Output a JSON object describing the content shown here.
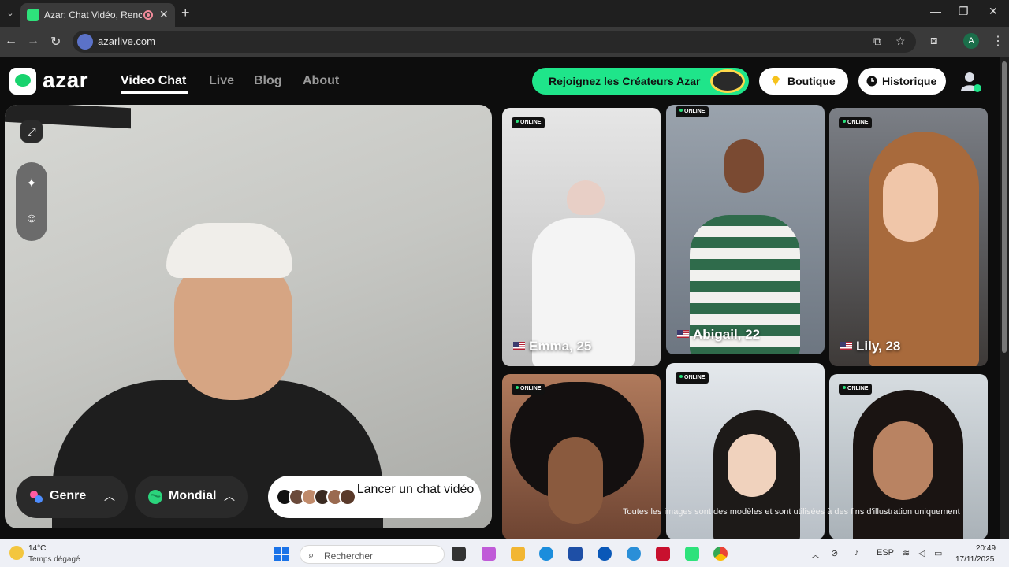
{
  "browser": {
    "tab_title": "Azar: Chat Vidéo, Rencontre",
    "url": "azarlive.com",
    "profile_initial": "A"
  },
  "site": {
    "logo": "azar",
    "nav": [
      "Video Chat",
      "Live",
      "Blog",
      "About"
    ],
    "active_nav": "Video Chat",
    "creator_cta": "Rejoignez les Créateurs Azar",
    "shop": "Boutique",
    "history": "Historique"
  },
  "video": {
    "gender_filter": "Genre",
    "region_filter": "Mondial",
    "start_button": "Lancer un chat vidéo"
  },
  "profiles": [
    {
      "name": "Emma, 25",
      "status": "ONLINE",
      "country": "US"
    },
    {
      "name": "Abigail, 22",
      "status": "ONLINE",
      "country": "US"
    },
    {
      "name": "Lily, 28",
      "status": "ONLINE",
      "country": "US"
    },
    {
      "name": "",
      "status": "ONLINE"
    },
    {
      "name": "",
      "status": "ONLINE"
    },
    {
      "name": "",
      "status": "ONLINE"
    }
  ],
  "disclaimer": "Toutes les images sont des modèles et sont utilisées à des fins d'illustration uniquement",
  "taskbar": {
    "temperature": "14°C",
    "weather": "Temps dégagé",
    "search_placeholder": "Rechercher",
    "language": "ESP",
    "time": "20:49",
    "date": "17/11/2025"
  },
  "colors": {
    "accent": "#1fe58a",
    "online_dot": "#28e07a"
  }
}
